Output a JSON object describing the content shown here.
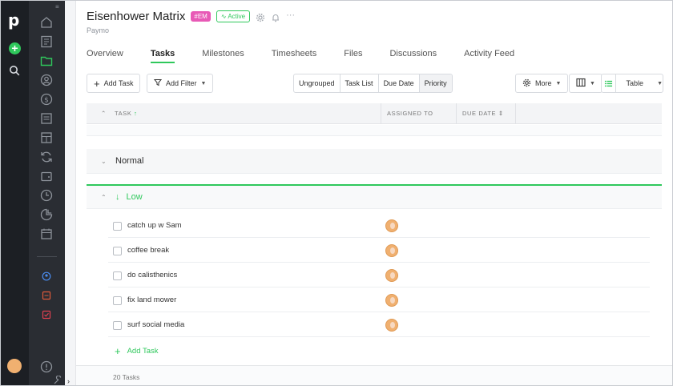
{
  "project": {
    "title": "Eisenhower Matrix",
    "tag": "#EM",
    "status": "Active",
    "company": "Paymo"
  },
  "tabs": [
    "Overview",
    "Tasks",
    "Milestones",
    "Timesheets",
    "Files",
    "Discussions",
    "Activity Feed"
  ],
  "active_tab": "Tasks",
  "toolbar": {
    "add_task": "Add Task",
    "add_filter": "Add Filter",
    "grouping": [
      "Ungrouped",
      "Task List",
      "Due Date",
      "Priority"
    ],
    "grouping_selected": "Priority",
    "more": "More",
    "view": "Table"
  },
  "table": {
    "columns": [
      "TASK",
      "ASSIGNED TO",
      "DUE DATE"
    ]
  },
  "groups": {
    "normal": "Normal",
    "low": "Low"
  },
  "tasks": [
    {
      "name": "catch up w Sam"
    },
    {
      "name": "coffee break"
    },
    {
      "name": "do calisthenics"
    },
    {
      "name": "fix land mower"
    },
    {
      "name": "surf social media"
    }
  ],
  "add_task_row": "Add Task",
  "footer": {
    "count": "20 Tasks"
  },
  "colors": {
    "accent": "#2fc85c",
    "tag": "#e85ab6",
    "rail": "#1c1f24",
    "nav": "#2a2d33"
  }
}
